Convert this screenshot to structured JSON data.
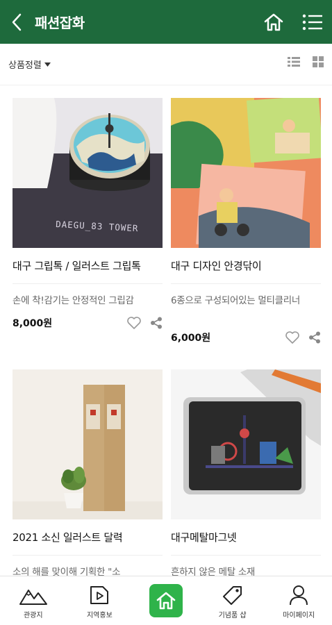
{
  "header": {
    "title": "패션잡화"
  },
  "sort": {
    "label": "상품정렬"
  },
  "products": [
    {
      "title": "대구 그립톡 / 일러스트 그립톡",
      "description": "손에 착!감기는 안정적인 그립감",
      "price": "8,000원"
    },
    {
      "title": "대구 디자인 안경닦이",
      "description": "6종으로 구성되어있는 멀티클리너",
      "price": "6,000원"
    },
    {
      "title": "2021 소신 일러스트 달력",
      "description": "소의 해를 맞이해 기획한 \"소"
    },
    {
      "title": "대구메탈마그넷",
      "description": "흔하지 않은 메탈 소재"
    }
  ],
  "image_text": {
    "grip_caption": "DAEGU_83 TOWER"
  },
  "bottom_nav": {
    "tour": "관광지",
    "promo": "지역홍보",
    "souvenir": "기념품 샵",
    "mypage": "마이페이지"
  },
  "colors": {
    "header": "#1e6a3c",
    "home_accent": "#2fb34a"
  }
}
